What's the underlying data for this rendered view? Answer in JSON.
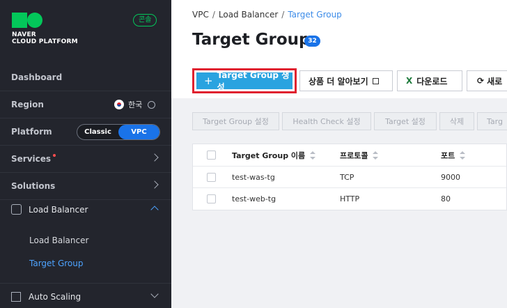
{
  "brand": {
    "line1": "NAVER",
    "line2": "CLOUD PLATFORM",
    "console_badge": "콘솔",
    "color": "#03c75a"
  },
  "sidebar": {
    "dashboard": "Dashboard",
    "region_label": "Region",
    "region_value": "한국",
    "platform_label": "Platform",
    "platform_options": [
      "Classic",
      "VPC"
    ],
    "platform_selected": "VPC",
    "services": "Services",
    "solutions": "Solutions",
    "load_balancer": "Load Balancer",
    "sub_items": [
      "Load Balancer",
      "Target Group"
    ],
    "active_sub_item": "Target Group",
    "auto_scaling": "Auto Scaling"
  },
  "breadcrumb": {
    "items": [
      "VPC",
      "Load Balancer"
    ],
    "current": "Target Group",
    "separator": "/"
  },
  "page": {
    "title": "Target Group",
    "count": "32"
  },
  "actions": {
    "create": "Target Group 생성",
    "learn_more": "상품 더 알아보기",
    "download": "다운로드",
    "refresh": "새로"
  },
  "toolbar": [
    "Target Group 설정",
    "Health Check 설정",
    "Target 설정",
    "삭제",
    "Targ"
  ],
  "table": {
    "columns": [
      "Target Group 이름",
      "프로토콜",
      "포트"
    ],
    "rows": [
      {
        "name": "test-was-tg",
        "protocol": "TCP",
        "port": "9000"
      },
      {
        "name": "test-web-tg",
        "protocol": "HTTP",
        "port": "80"
      }
    ]
  },
  "colors": {
    "accent": "#1a73e8",
    "primary_button": "#2aa3e0",
    "highlight_border": "#e0212f",
    "sidebar_bg": "#23252d"
  }
}
